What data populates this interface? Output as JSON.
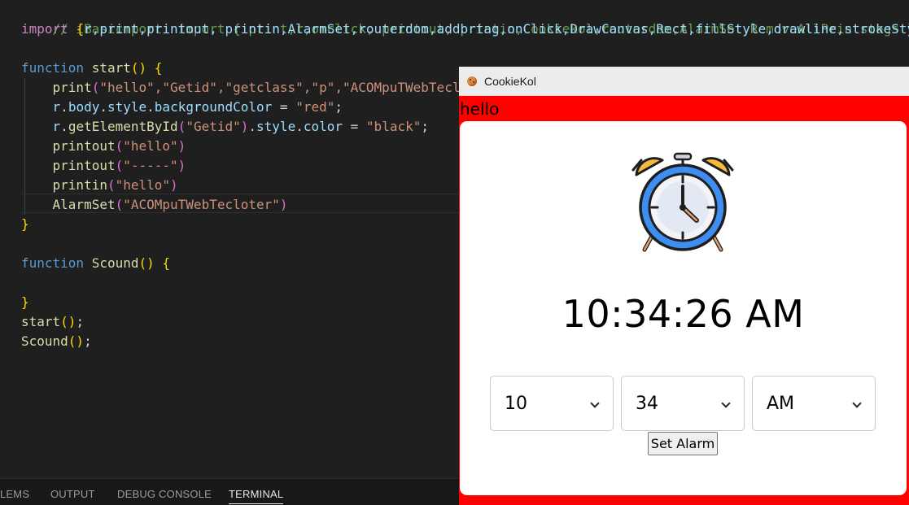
{
  "editor": {
    "line1_comment": "// iBasicmport  import { print,r,onclick, printout, printin,Cookiekol,routerdom,AlarmSet,RemoveAllPrintstags } fro",
    "line2_import_kw": "import",
    "line2_names": "r,print,printout, printin,AlarmSet,routerdom,addbrtag,onClick,DrawCanvas,Rect,fillStyle,drawline,strokeSty",
    "fn_kw": "function",
    "start_name": "start",
    "print_fn": "print",
    "print_args": "\"hello\",\"Getid\",\"getclass\",\"p\",\"ACOMpuTWebTecl",
    "body_r": "r",
    "body_body": "body",
    "body_style": "style",
    "body_prop": "backgroundColor",
    "body_value": "\"red\"",
    "getel_fn": "getElementById",
    "getel_arg": "\"Getid\"",
    "color_prop": "color",
    "color_value": "\"black\"",
    "printout_fn": "printout",
    "printout_arg1": "\"hello\"",
    "printout_arg2": "\"-----\"",
    "printin_fn": "printin",
    "printin_arg": "\"hello\"",
    "alarmset_fn": "AlarmSet",
    "alarmset_arg": "\"ACOMpuTWebTecloter\"",
    "scound_name": "Scound",
    "call_start": "start",
    "call_scound": "Scound"
  },
  "panel": {
    "tabs": [
      "LEMS",
      "OUTPUT",
      "DEBUG CONSOLE",
      "TERMINAL"
    ],
    "active_tab": "TERMINAL"
  },
  "window": {
    "title": "CookieKol",
    "hello": "hello",
    "time": "10:34:26 AM",
    "hour": "10",
    "minute": "34",
    "ampm": "AM",
    "set_alarm_label": "Set Alarm",
    "background_color": "#ff0000"
  },
  "icons": [
    "cookie-icon",
    "alarm-clock-icon",
    "chevron-down-icon"
  ]
}
